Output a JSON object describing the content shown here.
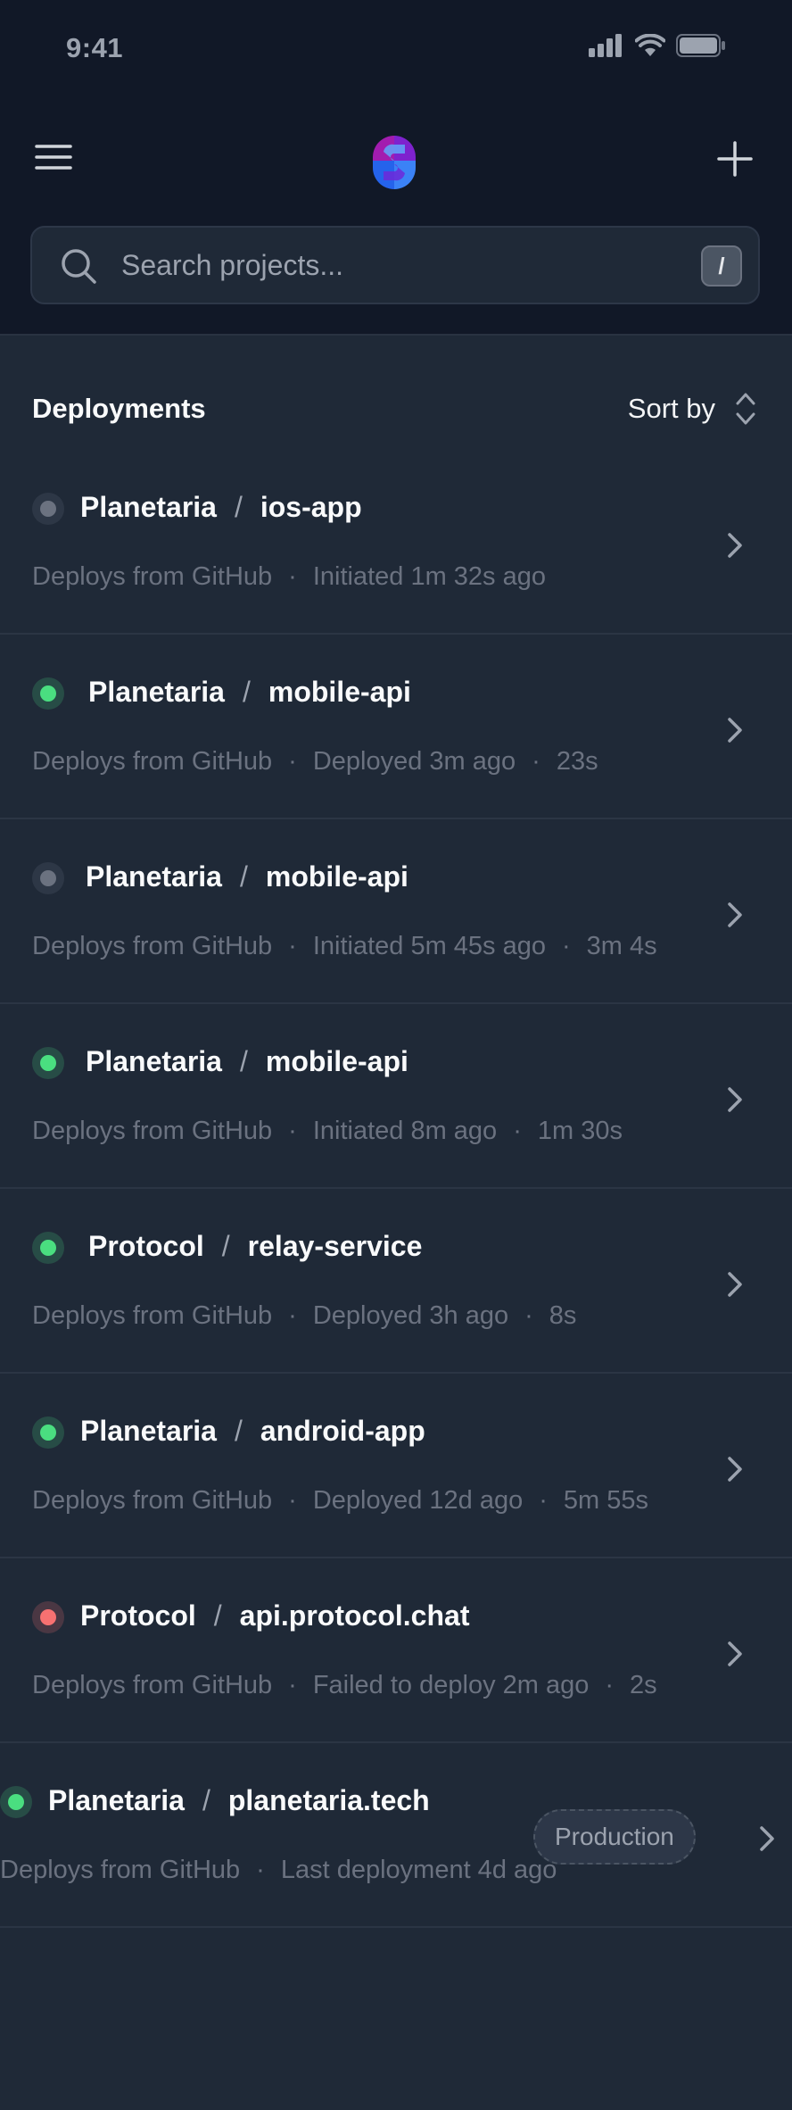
{
  "status_bar": {
    "time": "9:41"
  },
  "header": {
    "menu_icon": "hamburger-menu-icon",
    "logo_icon": "brand-logo-icon",
    "add_icon": "plus-icon"
  },
  "search": {
    "placeholder": "Search projects...",
    "value": "",
    "shortcut": "/"
  },
  "section": {
    "title": "Deployments",
    "sort_label": "Sort by"
  },
  "colors": {
    "ready": "#4ade80",
    "queued": "#6b7280",
    "error": "#f87171"
  },
  "deployments": [
    {
      "status": "queued",
      "org": "Planetaria",
      "repo": "ios-app",
      "source": "Deploys from GitHub",
      "info": "Initiated 1m 32s ago",
      "duration": ""
    },
    {
      "status": "ready",
      "org": "Planetaria",
      "repo": "mobile-api",
      "source": "Deploys from GitHub",
      "info": "Deployed 3m ago",
      "duration": "23s"
    },
    {
      "status": "queued",
      "org": "Planetaria",
      "repo": "mobile-api",
      "source": "Deploys from GitHub",
      "info": "Initiated 5m 45s ago",
      "duration": "3m 4s"
    },
    {
      "status": "ready",
      "org": "Planetaria",
      "repo": "mobile-api",
      "source": "Deploys from GitHub",
      "info": "Initiated 8m ago",
      "duration": "1m 30s"
    },
    {
      "status": "ready",
      "org": "Protocol",
      "repo": "relay-service",
      "source": "Deploys from GitHub",
      "info": "Deployed 3h ago",
      "duration": "8s"
    },
    {
      "status": "ready",
      "org": "Planetaria",
      "repo": "android-app",
      "source": "Deploys from GitHub",
      "info": "Deployed 12d ago",
      "duration": "5m 55s"
    },
    {
      "status": "error",
      "org": "Protocol",
      "repo": "api.protocol.chat",
      "source": "Deploys from GitHub",
      "info": "Failed to deploy 2m ago",
      "duration": "2s"
    },
    {
      "status": "ready",
      "org": "Planetaria",
      "repo": "planetaria.tech",
      "source": "Deploys from GitHub",
      "info": "Last deployment 4d ago",
      "duration": "",
      "badge": "Production"
    }
  ]
}
